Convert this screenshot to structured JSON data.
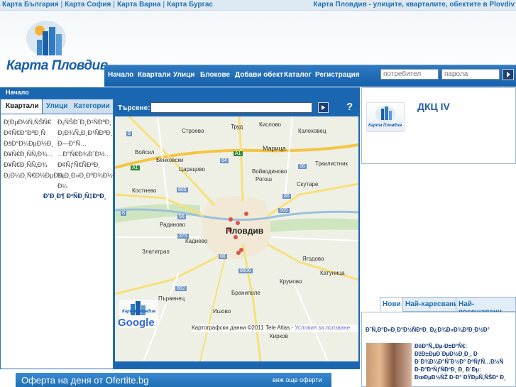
{
  "topbar": {
    "links": [
      "Карта България",
      "Карта София",
      "Карта Варна",
      "Карта Бургас"
    ],
    "separator": "|",
    "tagline": "Карта Пловдив - улиците, кварталите, обектите в Plovdiv"
  },
  "brand": {
    "name": "Карта Пловдив"
  },
  "nav": {
    "items": [
      "Начало",
      "Квартали",
      "Улици",
      "Блокове",
      "Добави обект",
      "Каталог",
      "Регистрация"
    ],
    "username_placeholder": "потребител",
    "password_placeholder": "парола"
  },
  "breadcrumb": "Начало",
  "left_panel": {
    "tabs": [
      "Квартали",
      "Улици",
      "Категории"
    ],
    "active_tab": "Квартали",
    "col1": [
      "Ð¦ÐµÐ½Ñ‚ÑŠÑ€",
      "Ð¢Ñ€Ð°ÐºÐ¸Ñ",
      "ÐšÐ°Ð¼ÐµÐ½Ð¸",
      "Ð¥Ñ€Ð¸ÑÑ‚Ð¾...",
      "Ð¥Ñ€Ð¸ÑÑ‚Ð¾",
      "Ð¡Ð¼Ð¸Ñ€Ð½ÐµÐ½..."
    ],
    "col2": [
      "Ð¡ÑŠÐ´Ð¸Ð¹ÑÐºÐ¸",
      "Ð¡Ð¾Ñ„Ð¸Ð¹ÑÐºÐ¸...",
      "Ð—Ð°Ñ…",
      "...Ð°Ñ€Ð¾Ð´Ð½...",
      "Ð¢ÑƒÑ€ÑÐºÐ¸",
      "Ð¡Ð¸Ð»Ð¸ÐºÐ¾Ð½ÐºÐ¸",
      "Ð¼"
    ],
    "all_link": "Ð’Ð¸Ð¶ Ð²ÑÐ¸Ñ‡ÐºÐ¸"
  },
  "map_panel": {
    "search_label": "Търсене:",
    "help": "?",
    "city_label": "Пловдив",
    "places": [
      "Строево",
      "Труд",
      "Кислово",
      "Калековец",
      "Войсил",
      "Бенковски",
      "Царацово",
      "Марица",
      "Тркилистник",
      "Войводиново",
      "Рогош",
      "Скутаре",
      "Костиево",
      "Радиново",
      "Кадиево",
      "Златитрап",
      "Ягодово",
      "Катуница",
      "Крумово",
      "Браниполе",
      "Първенец",
      "Кирков",
      "Ишово"
    ],
    "roads": [
      "A1",
      "A1",
      "64",
      "56",
      "805",
      "8",
      "8",
      "56",
      "565",
      "86",
      "375",
      "8606",
      "862",
      "86"
    ],
    "copyright": "Картографски данни ©2011 Tele Atlas -",
    "terms_link": "Условия за ползване",
    "google_logo": "Google",
    "watermark": "Карта Пловдив"
  },
  "banner": {
    "text": "Оферта на деня от Ofertite.bg",
    "more": "виж още оферти"
  },
  "right_panel": {
    "title": "ДКЦ IV",
    "thumb_label": "Карта Пловдив",
    "tabs": [
      "Нови",
      "Най-харесвани",
      "Най-посещавани"
    ],
    "active_tab": "Нови",
    "garbled_heading": "Ð˜Ñ‚Ð°Ð»Ð¸Ð°Ð½ÑÐºÐ¸ Ð¿Ð¾Ð»Ð¾Ð²Ð¸Ð½Ð°",
    "garbled_lines": [
      "ÐšÐ°Ñ„Ðµ-Ð±Ð°Ñ€:",
      "ÐžÐ±ÐµÐ´ÐµÐ½Ð¸Ð¸, Ð",
      "Ð´Ð¾Ð¼Ð°ÑˆÐ½Ð° ÐºÑƒÑ…Ð½Ñ",
      "Ð·Ð°ÐºÑƒÑÐºÐ¸ Ð¸ Ð´Ðµ:",
      "ÐœÐµÐ½ÑŽ Ð·Ð° ÐŸÐµÑ‚ÑŠÐº Ð¸"
    ]
  },
  "colors": {
    "accent": "#1a66b1",
    "nav": "#1f69b2",
    "link": "#1f6fb0"
  }
}
